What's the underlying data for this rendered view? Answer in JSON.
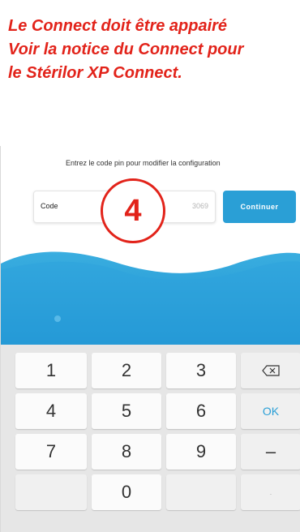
{
  "instruction": {
    "line1": "Le Connect doit être appairé",
    "line2": "Voir la notice du Connect pour",
    "line3": "le Stérilor XP Connect."
  },
  "screen": {
    "prompt": "Entrez le code pin pour modifier la configuration",
    "code_label": "Code",
    "code_value": "3069",
    "continue_label": "Continuer"
  },
  "step_badge": "4",
  "keypad": {
    "keys": [
      "1",
      "2",
      "3",
      "4",
      "5",
      "6",
      "7",
      "8",
      "9",
      "0"
    ],
    "ok_label": "OK",
    "dash_label": "–",
    "dot_label": "."
  },
  "colors": {
    "accent_red": "#e2231a",
    "accent_blue": "#2a9fd6",
    "keypad_bg": "#e6e6e6"
  }
}
